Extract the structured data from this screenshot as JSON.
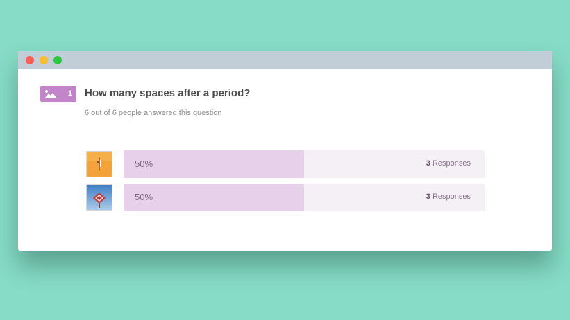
{
  "window": {
    "controls": [
      "close",
      "minimize",
      "zoom"
    ]
  },
  "question": {
    "type_icon": "image-icon",
    "number": "1",
    "title": "How many spaces after a period?",
    "answered_text": "6 out of 6 people answered this question"
  },
  "answers": [
    {
      "image": "cursor-on-orange-image",
      "percent_label": "50%",
      "percent_value": 50,
      "response_count": "3",
      "response_label": "Responses"
    },
    {
      "image": "red-sign-on-blue-sky-image",
      "percent_label": "50%",
      "percent_value": 50,
      "response_count": "3",
      "response_label": "Responses"
    }
  ],
  "colors": {
    "background": "#86dcc6",
    "accent": "#c385ca",
    "bar_fill": "#e7d0e9",
    "bar_track": "#f5eff6"
  }
}
